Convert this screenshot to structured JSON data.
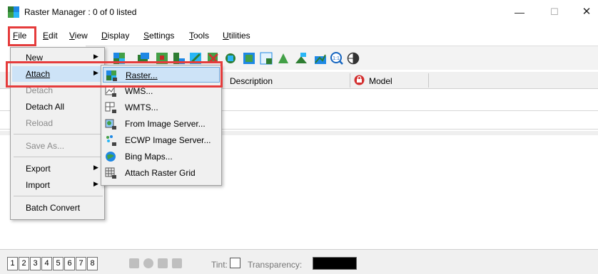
{
  "window": {
    "title": "Raster Manager : 0 of 0 listed",
    "minimize_glyph": "—",
    "maximize_glyph": "☐",
    "close_glyph": "✕"
  },
  "menubar": {
    "items": [
      {
        "label": "File",
        "key": "F",
        "rest": "ile"
      },
      {
        "label": "Edit",
        "key": "E",
        "rest": "dit"
      },
      {
        "label": "View",
        "key": "V",
        "rest": "iew"
      },
      {
        "label": "Display",
        "key": "D",
        "rest": "isplay"
      },
      {
        "label": "Settings",
        "key": "S",
        "rest": "ettings"
      },
      {
        "label": "Tools",
        "key": "T",
        "rest": "ools"
      },
      {
        "label": "Utilities",
        "key": "U",
        "rest": "tilities"
      }
    ]
  },
  "file_menu": {
    "new": "New",
    "attach": "Attach",
    "detach": "Detach",
    "detach_all": "Detach All",
    "reload": "Reload",
    "save_as": "Save As...",
    "export": "Export",
    "import": "Import",
    "batch_convert": "Batch Convert",
    "arrow": "▶"
  },
  "attach_submenu": {
    "items": [
      {
        "label": "Raster...",
        "icon": "raster-icon"
      },
      {
        "label": "WMS...",
        "icon": "wms-icon"
      },
      {
        "label": "WMTS...",
        "icon": "wmts-icon"
      },
      {
        "label": "From Image Server...",
        "icon": "image-server-icon"
      },
      {
        "label": "ECWP Image Server...",
        "icon": "ecwp-icon"
      },
      {
        "label": "Bing Maps...",
        "icon": "bing-maps-icon"
      },
      {
        "label": "Attach Raster Grid",
        "icon": "raster-grid-icon"
      }
    ]
  },
  "list": {
    "columns": {
      "description": "Description",
      "model": "Model"
    }
  },
  "statusbar": {
    "views": [
      "1",
      "2",
      "3",
      "4",
      "5",
      "6",
      "7",
      "8"
    ],
    "tint_label": "Tint:",
    "transparency_label": "Transparency:"
  },
  "colors": {
    "highlight_red": "#e53c3c",
    "menu_hover": "#cde3f7"
  }
}
